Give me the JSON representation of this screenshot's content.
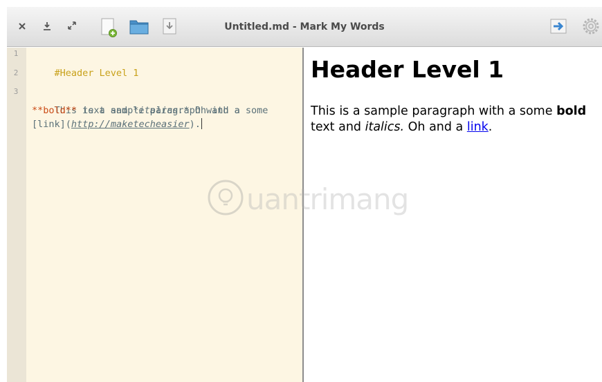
{
  "window": {
    "title": "Untitled.md - Mark My Words"
  },
  "toolbar": {
    "icons": [
      "close-icon",
      "minimize-icon",
      "maximize-icon",
      "new-file-icon",
      "open-folder-icon",
      "save-icon",
      "export-icon",
      "gear-icon"
    ]
  },
  "editor": {
    "line_numbers": [
      "1",
      "2",
      "3"
    ],
    "lines": {
      "l1": "#Header Level 1",
      "l3a": "This is a sample paragraph with a some",
      "l3b_bold": "**bold**",
      "l3b_mid": " text and ",
      "l3b_italic": "*italics.*",
      "l3b_end": " Oh and a",
      "l3c_link": "[link]",
      "l3c_open": "(",
      "l3c_url": "http://maketecheasier",
      "l3c_close": ")."
    }
  },
  "preview": {
    "heading": "Header Level 1",
    "p_start": "This is a sample paragraph with a some ",
    "p_bold": "bold",
    "p_mid": " text and ",
    "p_italic": "italics.",
    "p_mid2": " Oh and a ",
    "p_link": "link",
    "p_end": "."
  },
  "watermark": {
    "text": "uantrimang"
  },
  "colors": {
    "editor_bg": "#fdf6e3",
    "gutter_bg": "#ebe5d6",
    "markdown_header": "#c8a11a",
    "markdown_bold": "#cb4b16",
    "link": "#0000ee"
  }
}
